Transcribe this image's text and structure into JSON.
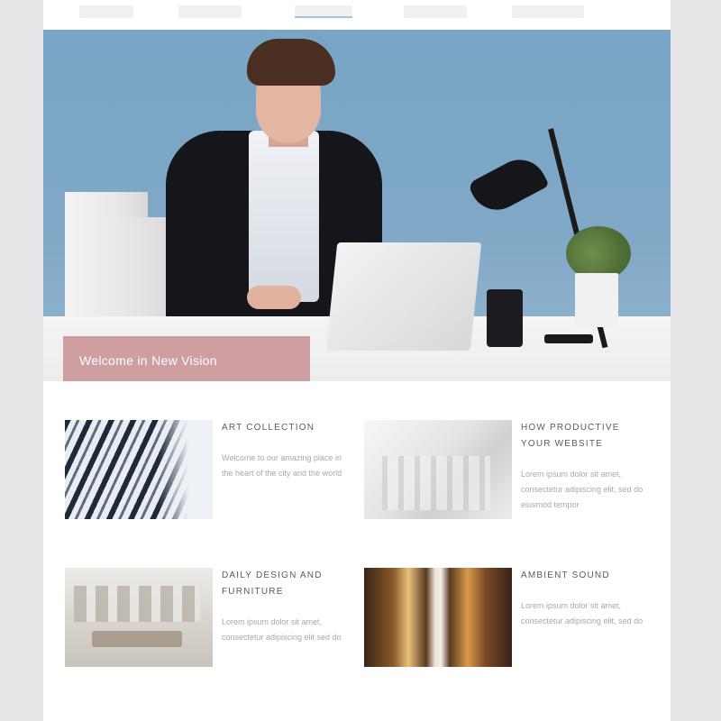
{
  "hero": {
    "welcome_text": "Welcome in New Vision"
  },
  "features": [
    {
      "title": "Art Collection",
      "description": "Welcome to our amazing place in the heart of the city and the world"
    },
    {
      "title": "How Productive Your Website",
      "description": "Lorem ipsum dolor sit amet, consectetur adipiscing elit, sed do eiusmod tempor"
    },
    {
      "title": "Daily Design And Furniture",
      "description": "Lorem ipsum dolor sit amet, consectetur adipiscing elit sed do"
    },
    {
      "title": "Ambient Sound",
      "description": "Lorem ipsum dolor sit amet, consectetur adipiscing elit, sed do"
    }
  ],
  "icons": {
    "hero_image": "office-woman-photo",
    "thumb_1": "building-facade-photo",
    "thumb_2": "white-architecture-photo",
    "thumb_3": "interior-room-photo",
    "thumb_4": "warm-lights-photo"
  },
  "colors": {
    "banner": "#cf9ea0",
    "nav_active": "#a6c3db",
    "page_bg": "#e6e6e8"
  }
}
